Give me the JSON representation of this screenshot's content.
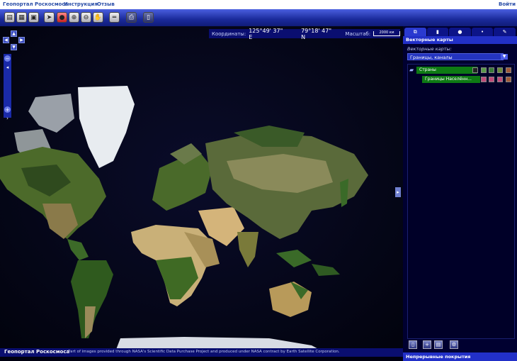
{
  "header": {
    "links": [
      "Геопортал Роскосмоса",
      "Инструкция",
      "Отзыв"
    ],
    "login": "Войти"
  },
  "toolbar": {
    "icons": [
      "layers-icon",
      "image-icon",
      "photo-icon",
      "pointer-icon",
      "stop-icon",
      "zoom-in-icon",
      "zoom-out-icon",
      "pan-icon",
      "ruler-icon",
      "print-icon",
      "info-icon"
    ]
  },
  "coords": {
    "label": "Координаты:",
    "lon": "125°49' 37\" E",
    "lat": "79°18' 47\" N",
    "scale_label": "Масштаб:",
    "scale_value": "2000 км"
  },
  "footer": {
    "brand": "Геопортал Роскосмоса",
    "credit": "Part of images provided through NASA's Scientific Data Purchase Project and produced under NASA contract by Earth Satellite Corporation."
  },
  "panel": {
    "tabs": [
      "layers-tab",
      "document-tab",
      "circle-tab",
      "dot-tab",
      "tools-tab"
    ],
    "header": "Векторные карты",
    "label": "Векторные карты:",
    "select_value": "Границы, каналы",
    "layers": [
      {
        "name": "Страны"
      },
      {
        "name": "Границы Населённ..."
      }
    ],
    "bottom_header": "Непрерывные покрытия"
  },
  "colors": {
    "accent": "#2230c8",
    "toolbar": "#1a2a9a",
    "layer_row": "#0e7a14"
  }
}
